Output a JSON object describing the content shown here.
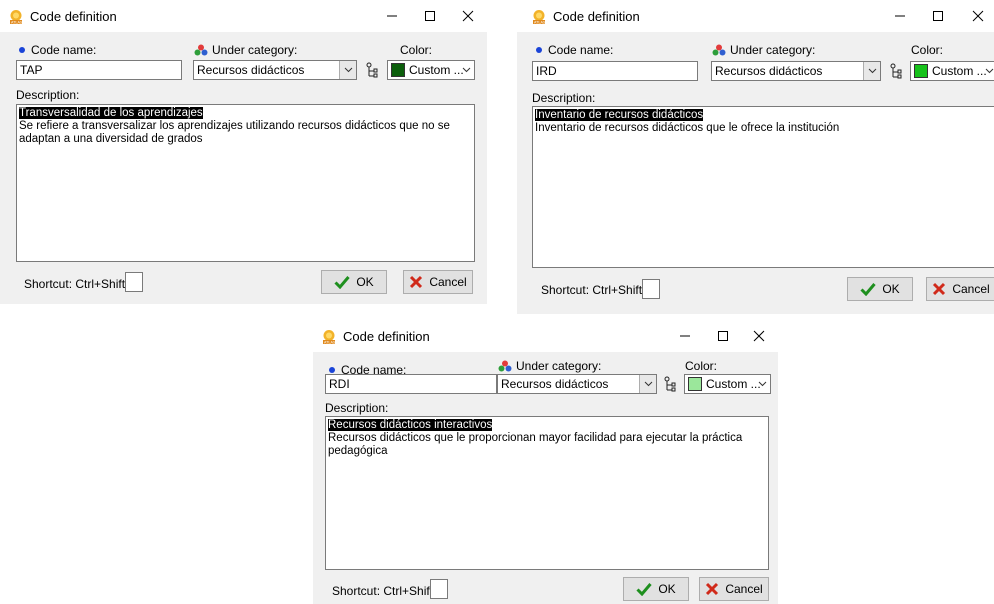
{
  "dialogs": [
    {
      "title": "Code definition",
      "code_name_label": "Code name:",
      "code_name_value": "TAP",
      "under_category_label": "Under category:",
      "under_category_value": "Recursos didácticos",
      "color_label": "Color:",
      "color_value": "Custom ...",
      "color_swatch": "#0b5e0b",
      "description_label": "Description:",
      "description_selected": "Transversalidad de los aprendizajes",
      "description_body": "Se refiere a  transversalizar los aprendizajes  utilizando recursos didácticos que no se  adaptan a una diversidad de grados",
      "shortcut_label": "Shortcut: Ctrl+Shift+",
      "ok_label": "OK",
      "cancel_label": "Cancel"
    },
    {
      "title": "Code definition",
      "code_name_label": "Code name:",
      "code_name_value": "IRD",
      "under_category_label": "Under category:",
      "under_category_value": "Recursos didácticos",
      "color_label": "Color:",
      "color_value": "Custom ...",
      "color_swatch": "#17c21b",
      "description_label": "Description:",
      "description_selected": "Inventario de recursos didácticos",
      "description_body": "Inventario de recursos didácticos que le ofrece la institución",
      "shortcut_label": "Shortcut: Ctrl+Shift+",
      "ok_label": "OK",
      "cancel_label": "Cancel"
    },
    {
      "title": "Code definition",
      "code_name_label": "Code name:",
      "code_name_value": "RDI",
      "under_category_label": "Under category:",
      "under_category_value": "Recursos didácticos",
      "color_label": "Color:",
      "color_value": "Custom ...",
      "color_swatch": "#9be79b",
      "description_label": "Description:",
      "description_selected": "Recursos didácticos interactivos",
      "description_body": "Recursos didácticos que le proporcionan mayor facilidad para ejecutar la práctica pedagógica",
      "shortcut_label": "Shortcut: Ctrl+Shift+",
      "ok_label": "OK",
      "cancel_label": "Cancel"
    }
  ]
}
